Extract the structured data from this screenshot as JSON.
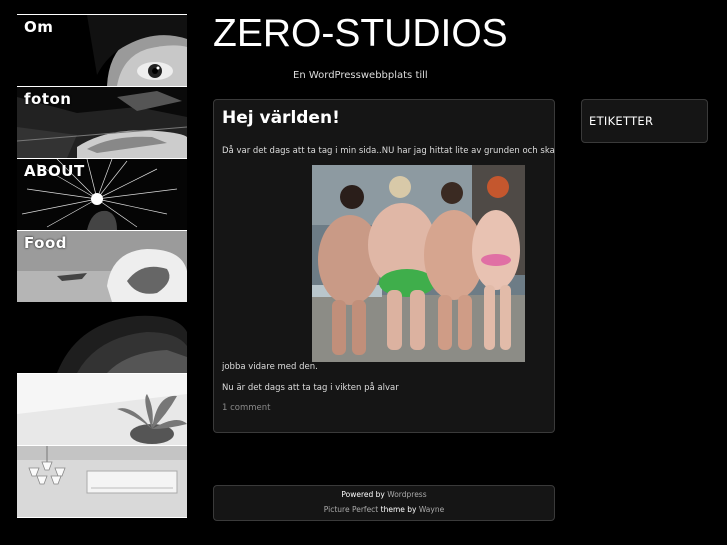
{
  "nav": {
    "items": [
      {
        "label": "Om"
      },
      {
        "label": "foton"
      },
      {
        "label": "ABOUT"
      },
      {
        "label": "Food"
      }
    ]
  },
  "header": {
    "title": "ZERO-STUDIOS",
    "tagline": "En WordPresswebbplats till"
  },
  "post": {
    "title": "Hej världen!",
    "line1": "Då var det dags att ta tag i min sida..NU har jag hittat lite av grunden och ska",
    "line2": "jobba vidare med den.",
    "line3": "Nu är det dags att ta tag i vikten på alvar",
    "comments": "1 comment"
  },
  "sidebar": {
    "widget_title": "ETIKETTER"
  },
  "footer": {
    "powered_prefix": "Powered by",
    "powered_link": "Wordpress",
    "theme_link": "Picture Perfect",
    "theme_word": "theme",
    "by_word": "by",
    "author_link": "Wayne"
  }
}
